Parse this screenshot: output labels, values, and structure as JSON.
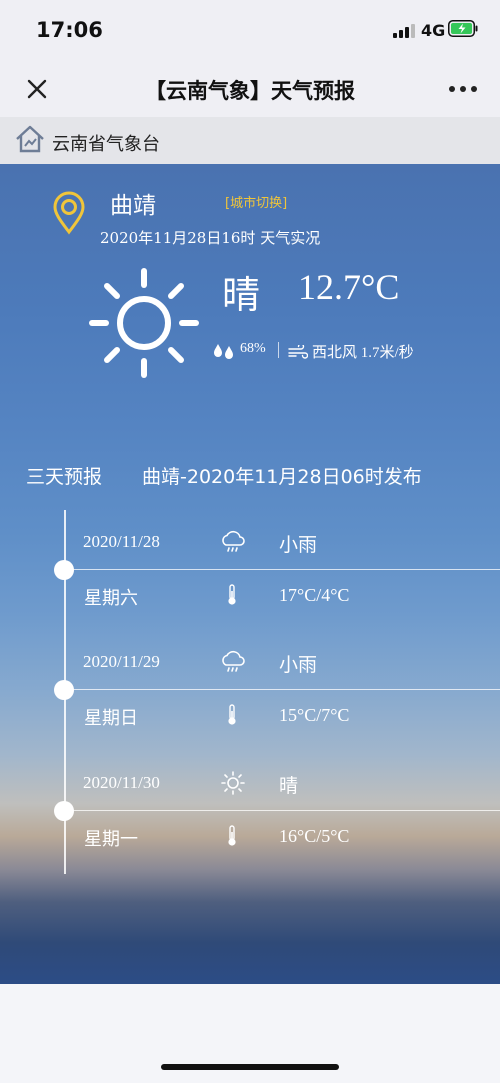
{
  "status_bar": {
    "time": "17:06",
    "network": "4G"
  },
  "nav": {
    "title": "【云南气象】天气预报",
    "close_icon": "close-icon",
    "more_icon": "more-icon"
  },
  "org": {
    "name": "云南省气象台",
    "icon": "home-icon"
  },
  "current": {
    "city": "曲靖",
    "switch_label": "[城市切换]",
    "observed_time": "2020年11月28日16时 天气实况",
    "condition": "晴",
    "temperature": "12.7°C",
    "humidity": "68%",
    "wind": "西北风 1.7米/秒",
    "icon": "sun-icon"
  },
  "forecast": {
    "title": "三天预报",
    "issued": "曲靖-2020年11月28日06时发布",
    "days": [
      {
        "date": "2020/11/28",
        "weekday": "星期六",
        "weather": "小雨",
        "temp_range": "17°C/4°C",
        "icon": "cloud-rain-icon"
      },
      {
        "date": "2020/11/29",
        "weekday": "星期日",
        "weather": "小雨",
        "temp_range": "15°C/7°C",
        "icon": "cloud-rain-icon"
      },
      {
        "date": "2020/11/30",
        "weekday": "星期一",
        "weather": "晴",
        "temp_range": "16°C/5°C",
        "icon": "sun-icon"
      }
    ]
  },
  "colors": {
    "accent_yellow": "#f0c53a",
    "sky_top": "#4a72b0",
    "bar_bg": "#efeff4"
  }
}
